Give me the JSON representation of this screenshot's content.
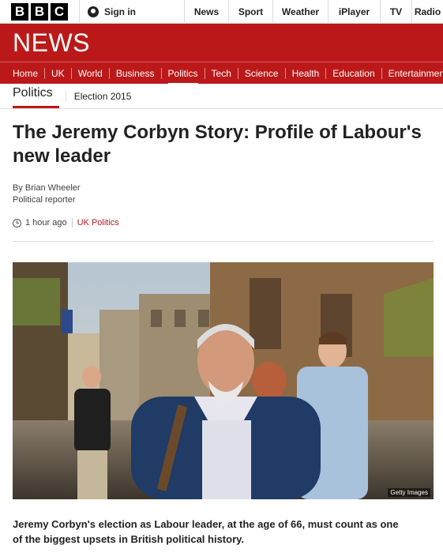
{
  "topbar": {
    "logo_letters": [
      "B",
      "B",
      "C"
    ],
    "signin_label": "Sign in",
    "nav": [
      {
        "label": "News",
        "w": 56
      },
      {
        "label": "Sport",
        "w": 56
      },
      {
        "label": "Weather",
        "w": 70
      },
      {
        "label": "iPlayer",
        "w": 66
      },
      {
        "label": "TV",
        "w": 40
      },
      {
        "label": "Radio",
        "w": 40
      }
    ]
  },
  "brand": {
    "title": "NEWS"
  },
  "section_nav": {
    "items": [
      "Home",
      "UK",
      "World",
      "Business",
      "Politics",
      "Tech",
      "Science",
      "Health",
      "Education",
      "Entertainment"
    ],
    "active": "Politics"
  },
  "subnav": {
    "primary": "Politics",
    "secondary": "Election 2015"
  },
  "article": {
    "headline": "The Jeremy Corbyn Story: Profile of Labour's new leader",
    "byline_name": "By Brian Wheeler",
    "byline_role": "Political reporter",
    "timestamp": "1 hour ago",
    "topic": "UK Politics",
    "image_credit": "Getty Images",
    "lede": "Jeremy Corbyn's election as Labour leader, at the age of 66, must count as one of the biggest upsets in British political history."
  },
  "colors": {
    "brand_red": "#bb1919",
    "text": "#222222"
  }
}
